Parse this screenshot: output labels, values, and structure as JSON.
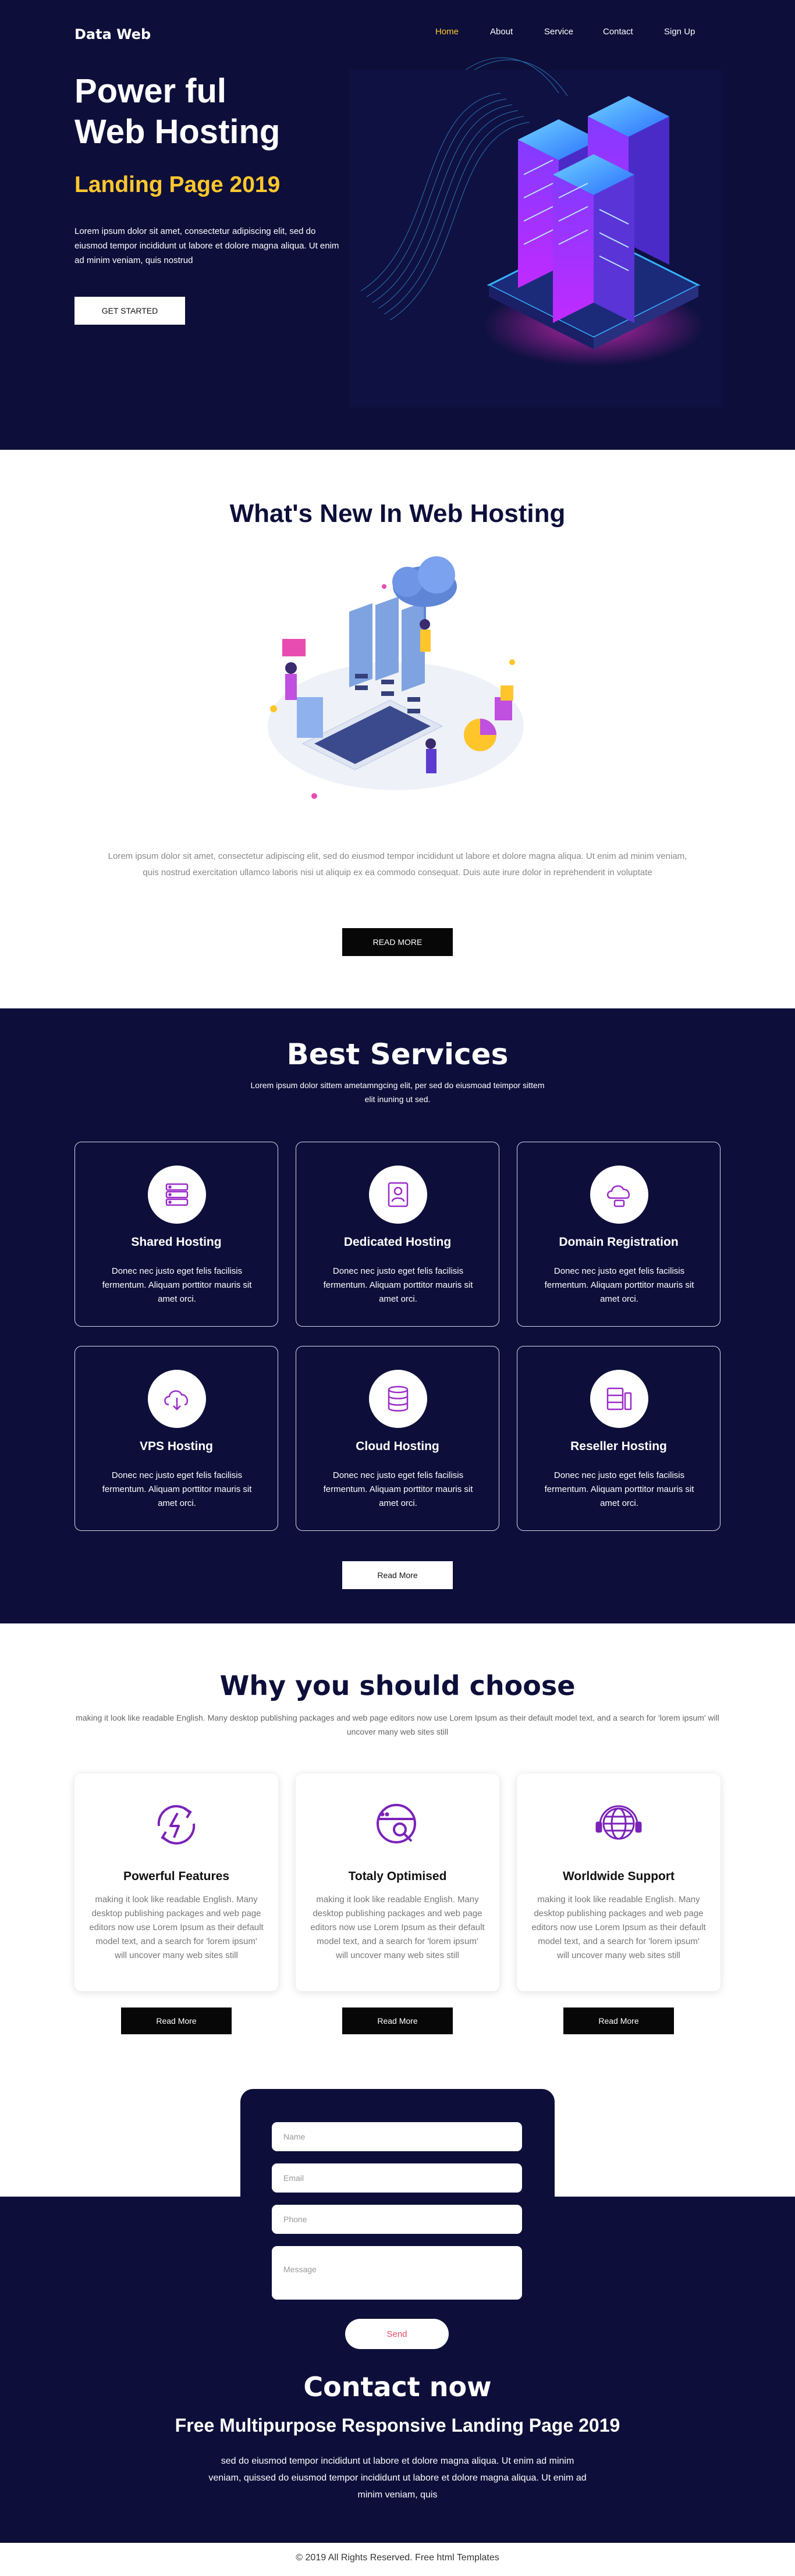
{
  "brand": {
    "logo": "Data Web"
  },
  "nav": {
    "items": [
      "Home",
      "About",
      "Service",
      "Contact",
      "Sign Up"
    ]
  },
  "hero": {
    "title_line1": "Power ful",
    "title_line2": "Web Hosting",
    "subtitle": "Landing Page 2019",
    "text": "Lorem ipsum dolor sit amet, consectetur adipiscing elit, sed do eiusmod tempor incididunt ut labore et dolore magna aliqua. Ut enim ad minim veniam, quis nostrud",
    "button": "GET STARTED"
  },
  "whats_new": {
    "title": "What's New In Web Hosting",
    "text": "Lorem ipsum dolor sit amet, consectetur adipiscing elit, sed do eiusmod tempor incididunt ut labore et dolore magna aliqua. Ut enim ad minim veniam, quis nostrud exercitation ullamco laboris nisi ut aliquip ex ea commodo consequat. Duis aute irure dolor in reprehenderit in voluptate",
    "button": "READ MORE"
  },
  "services": {
    "title": "Best Services",
    "subtitle": "Lorem ipsum dolor sittem ametamngcing elit, per sed do eiusmoad teimpor sittem elit inuning ut sed.",
    "items": [
      {
        "title": "Shared Hosting",
        "text": "Donec nec justo eget felis facilisis fermentum. Aliquam porttitor mauris sit amet orci.",
        "icon": "server-icon"
      },
      {
        "title": "Dedicated Hosting",
        "text": "Donec nec justo eget felis facilisis fermentum. Aliquam porttitor mauris sit amet orci.",
        "icon": "person-server-icon"
      },
      {
        "title": "Domain Registration",
        "text": "Donec nec justo eget felis facilisis fermentum. Aliquam porttitor mauris sit amet orci.",
        "icon": "cloud-server-icon"
      },
      {
        "title": "VPS Hosting",
        "text": "Donec nec justo eget felis facilisis fermentum. Aliquam porttitor mauris sit amet orci.",
        "icon": "cloud-download-icon"
      },
      {
        "title": "Cloud Hosting",
        "text": "Donec nec justo eget felis facilisis fermentum. Aliquam porttitor mauris sit amet orci.",
        "icon": "database-icon"
      },
      {
        "title": "Reseller Hosting",
        "text": "Donec nec justo eget felis facilisis fermentum. Aliquam porttitor mauris sit amet orci.",
        "icon": "server-rack-icon"
      }
    ],
    "button": "Read More"
  },
  "why": {
    "title": "Why you should choose",
    "subtitle": "making it look like readable English. Many desktop publishing packages and web page editors now use Lorem Ipsum as their default model text, and a search for 'lorem ipsum' will uncover many web sites still",
    "items": [
      {
        "title": "Powerful Features",
        "text": "making it look like readable English. Many desktop publishing packages and web page editors now use Lorem Ipsum as their default model text, and a search for 'lorem ipsum' will uncover many web sites still",
        "icon": "power-cycle-icon",
        "button": "Read More"
      },
      {
        "title": "Totaly Optimised",
        "text": "making it look like readable English. Many desktop publishing packages and web page editors now use Lorem Ipsum as their default model text, and a search for 'lorem ipsum' will uncover many web sites still",
        "icon": "browser-search-icon",
        "button": "Read More"
      },
      {
        "title": "Worldwide Support",
        "text": "making it look like readable English. Many desktop publishing packages and web page editors now use Lorem Ipsum as their default model text, and a search for 'lorem ipsum' will uncover many web sites still",
        "icon": "globe-support-icon",
        "button": "Read More"
      }
    ]
  },
  "contact_form": {
    "name_placeholder": "Name",
    "email_placeholder": "Email",
    "phone_placeholder": "Phone",
    "message_placeholder": "Message",
    "send": "Send"
  },
  "contact": {
    "title": "Contact now",
    "subtitle": "Free Multipurpose Responsive Landing Page 2019",
    "text": "sed do eiusmod tempor incididunt ut labore et dolore magna aliqua. Ut enim ad minim veniam, quissed do eiusmod tempor incididunt ut labore et dolore magna aliqua. Ut enim ad minim veniam, quis"
  },
  "footer": {
    "text": "© 2019 All Rights Reserved. Free html Templates"
  },
  "colors": {
    "navy": "#0d0f3a",
    "accent": "#ffc72c",
    "purple": "#7a22b8",
    "send": "#e84c66"
  }
}
